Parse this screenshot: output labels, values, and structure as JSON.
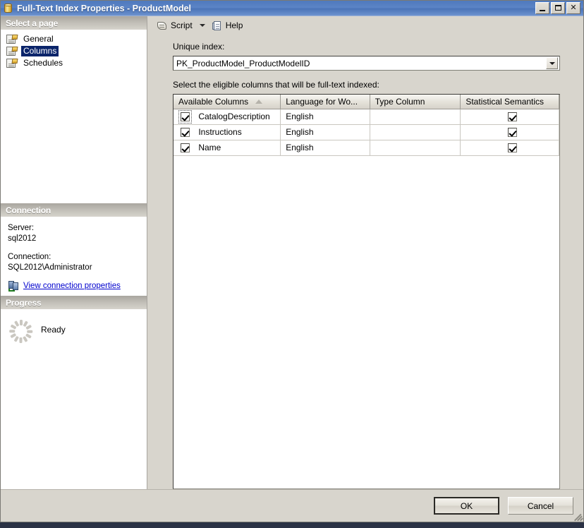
{
  "window": {
    "title": "Full-Text Index Properties - ProductModel",
    "icon": "database-cylinder-icon",
    "controls": {
      "minimize": "minimize-button",
      "maximize": "maximize-button",
      "close": "✕"
    }
  },
  "sidebar": {
    "select_page_header": "Select a page",
    "items": [
      {
        "label": "General",
        "selected": false
      },
      {
        "label": "Columns",
        "selected": true
      },
      {
        "label": "Schedules",
        "selected": false
      }
    ],
    "connection": {
      "header": "Connection",
      "server_label": "Server:",
      "server_value": "sql2012",
      "connection_label": "Connection:",
      "connection_value": "SQL2012\\Administrator",
      "view_properties_link": "View connection properties"
    },
    "progress": {
      "header": "Progress",
      "status": "Ready",
      "spinner": "loading-spinner-icon"
    }
  },
  "toolbar": {
    "script_label": "Script",
    "script_icon": "script-scroll-icon",
    "dropdown_icon": "chevron-down-icon",
    "help_label": "Help",
    "help_icon": "help-page-icon"
  },
  "main": {
    "unique_index_label": "Unique index:",
    "unique_index_value": "PK_ProductModel_ProductModelID",
    "columns_instruction": "Select the eligible columns that will be full-text indexed:",
    "grid": {
      "headers": [
        {
          "label": "Available Columns",
          "sort": "ascending"
        },
        {
          "label": "Language for Wo...",
          "sort": ""
        },
        {
          "label": "Type Column",
          "sort": ""
        },
        {
          "label": "Statistical Semantics",
          "sort": ""
        }
      ],
      "rows": [
        {
          "selected": true,
          "focused": true,
          "name": "CatalogDescription",
          "language": "English",
          "type_column": "",
          "statistical_semantics": true
        },
        {
          "selected": true,
          "focused": false,
          "name": "Instructions",
          "language": "English",
          "type_column": "",
          "statistical_semantics": true
        },
        {
          "selected": true,
          "focused": false,
          "name": "Name",
          "language": "English",
          "type_column": "",
          "statistical_semantics": true
        }
      ]
    }
  },
  "footer": {
    "ok_label": "OK",
    "cancel_label": "Cancel"
  },
  "colors": {
    "title_bar": "#4f79bd",
    "selection": "#0a246a",
    "dialog_face": "#d8d5cd",
    "link": "#0000cd",
    "bottom_strip": "#2b3245"
  }
}
